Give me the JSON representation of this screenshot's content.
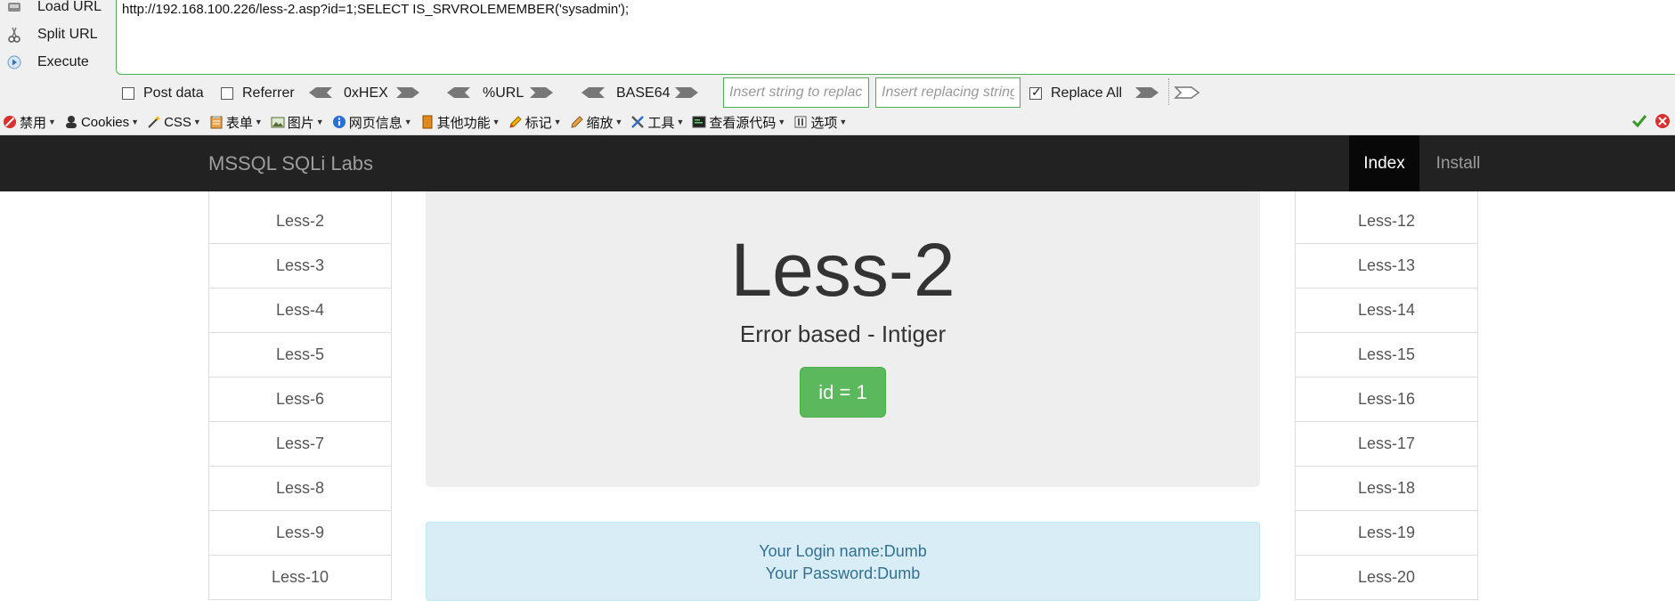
{
  "hackbar": {
    "buttons": [
      {
        "label": "Load URL",
        "icon": "load-url-icon"
      },
      {
        "label": "Split URL",
        "icon": "scissors-icon"
      },
      {
        "label": "Execute",
        "icon": "play-icon"
      }
    ],
    "url": "http://192.168.100.226/less-2.asp?id=1;SELECT IS_SRVROLEMEMBER('sysadmin');",
    "post_data_label": "Post data",
    "post_data_checked": false,
    "referrer_label": "Referrer",
    "referrer_checked": false,
    "hex_label": "0xHEX",
    "url_encode_label": "%URL",
    "base64_label": "BASE64",
    "insert_placeholder": "Insert string to replace",
    "replacing_placeholder": "Insert replacing string",
    "replace_all_label": "Replace All",
    "replace_all_checked": true,
    "accent_color": "#4caf50"
  },
  "menubar": {
    "items": [
      {
        "label": "禁用",
        "icon": "disable-icon"
      },
      {
        "label": "Cookies",
        "icon": "cookie-icon"
      },
      {
        "label": "CSS",
        "icon": "css-wand-icon"
      },
      {
        "label": "表单",
        "icon": "form-icon"
      },
      {
        "label": "图片",
        "icon": "image-icon"
      },
      {
        "label": "网页信息",
        "icon": "info-icon"
      },
      {
        "label": "其他功能",
        "icon": "misc-icon"
      },
      {
        "label": "标记",
        "icon": "pencil-icon"
      },
      {
        "label": "缩放",
        "icon": "resize-icon"
      },
      {
        "label": "工具",
        "icon": "tools-icon"
      },
      {
        "label": "查看源代码",
        "icon": "source-code-icon"
      },
      {
        "label": "选项",
        "icon": "options-icon"
      }
    ]
  },
  "navbar": {
    "brand": "MSSQL SQLi Labs",
    "index": "Index",
    "install": "Install",
    "bg_color": "#222222"
  },
  "left_lessons": [
    "Less-2",
    "Less-3",
    "Less-4",
    "Less-5",
    "Less-6",
    "Less-7",
    "Less-8",
    "Less-9",
    "Less-10"
  ],
  "right_lessons": [
    "Less-12",
    "Less-13",
    "Less-14",
    "Less-15",
    "Less-16",
    "Less-17",
    "Less-18",
    "Less-19",
    "Less-20"
  ],
  "main": {
    "title": "Less-2",
    "subtitle": "Error based - Intiger",
    "id_button": "id = 1",
    "login_line": "Your Login name:Dumb",
    "password_line": "Your Password:Dumb"
  }
}
